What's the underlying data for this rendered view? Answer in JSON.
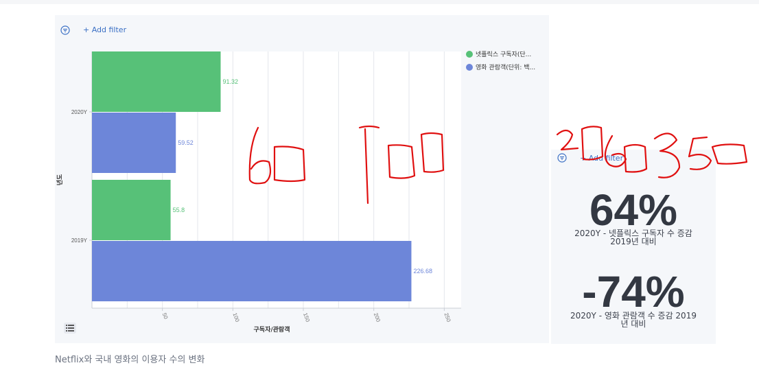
{
  "filters": {
    "main_add_filter": "+ Add filter",
    "side_add_filter": "+ Add filter"
  },
  "chart_data": {
    "type": "bar",
    "orientation": "horizontal",
    "categories": [
      "2020Y",
      "2019Y"
    ],
    "series": [
      {
        "name": "넷플릭스 구독자(단...",
        "color": "#57c178",
        "values": [
          91.32,
          55.8
        ]
      },
      {
        "name": "영화 관람객(단위: 백...",
        "color": "#6d86d9",
        "values": [
          59.52,
          226.68
        ]
      }
    ],
    "data_labels": [
      "91.32",
      "59.52",
      "55.8",
      "226.68"
    ],
    "xlabel": "구독자/관람객",
    "ylabel": "년도",
    "xlim": [
      0,
      262
    ],
    "xticks": [
      "50",
      "100",
      "150",
      "200",
      "250"
    ],
    "grid": true,
    "legend_position": "top-right"
  },
  "kpis": [
    {
      "value": "64%",
      "caption_line1": "2020Y - 넷플릭스 구독자 수 증감",
      "caption_line2": "2019년 대비"
    },
    {
      "value": "-74%",
      "caption_line1": "2020Y - 영화 관람객 수 증감 2019",
      "caption_line2": "년 대비"
    }
  ],
  "caption": "Netflix와 국내 영화의 이용자 수의 변화",
  "handwriting": {
    "left_text": "60700",
    "right_text": "2060350",
    "color": "#e01010"
  },
  "colors": {
    "netflix_green": "#57c178",
    "movie_blue": "#6d86d9",
    "link_blue": "#3a6fc4",
    "panel_bg": "#f5f7fa"
  }
}
